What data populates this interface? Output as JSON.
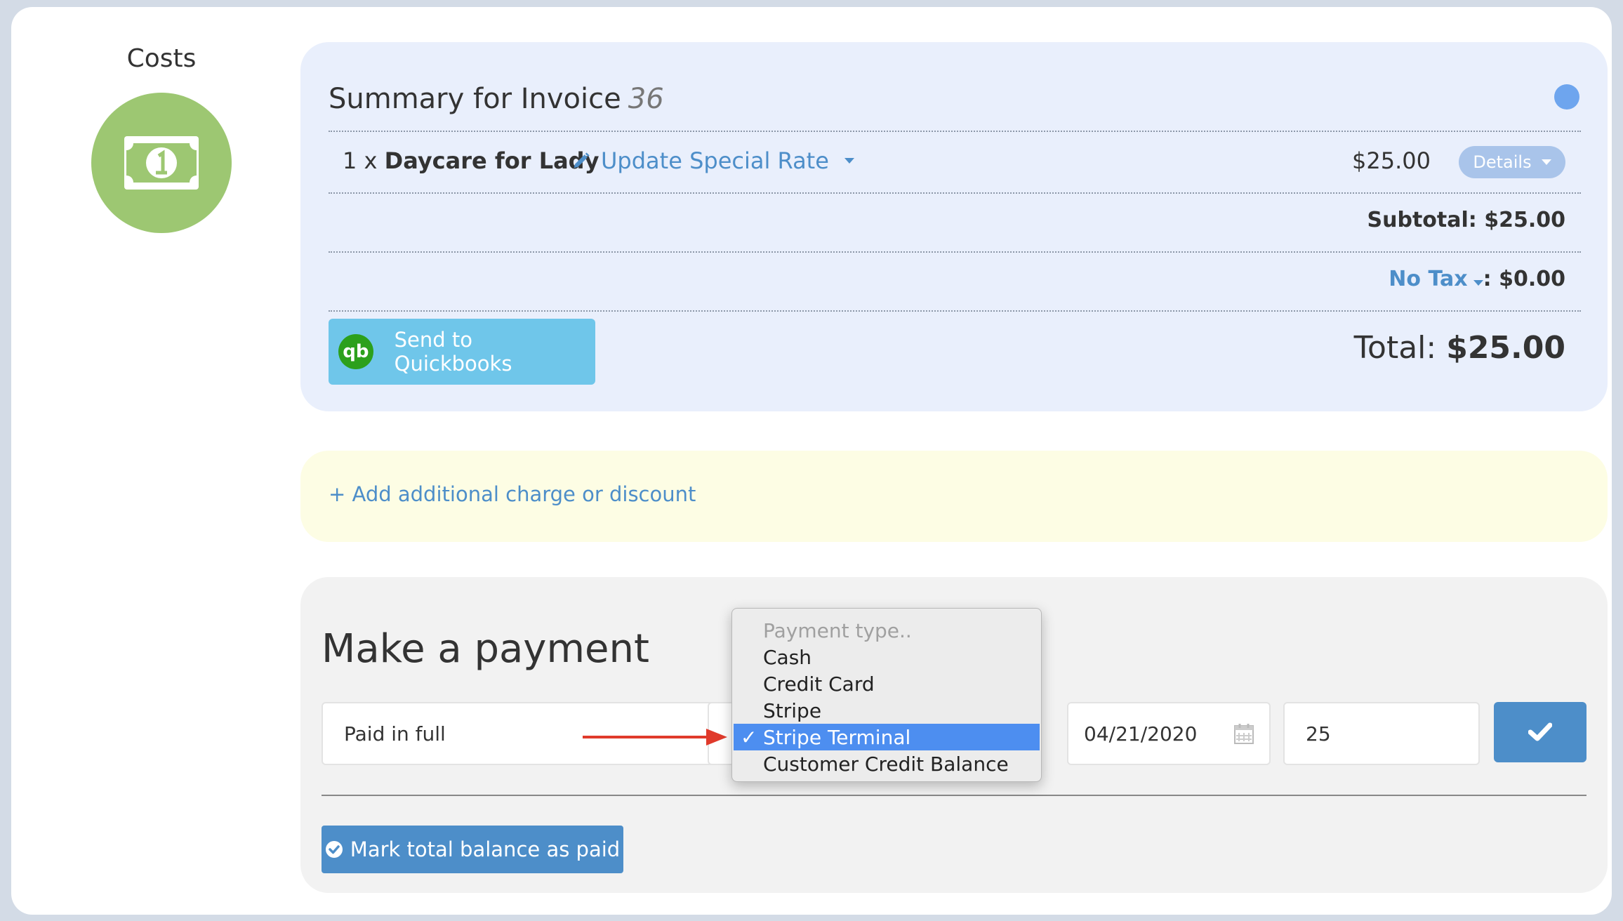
{
  "costs": {
    "label": "Costs",
    "icon": "money-icon",
    "accent": "#9dc772"
  },
  "summary": {
    "title": "Summary for Invoice",
    "invoice_number": "36",
    "status_color": "#6ea5ee",
    "line_item": {
      "qty_prefix": "1 x ",
      "name": "Daycare for Lady",
      "update_rate_label": "Update Special Rate",
      "price": "$25.00",
      "details_label": "Details"
    },
    "subtotal": "Subtotal: $25.00",
    "tax_label": "No Tax",
    "tax_amount": ": $0.00",
    "quickbooks_button": "Send to Quickbooks",
    "quickbooks_logo": "qb",
    "total_label": "Total: ",
    "total_value": "$25.00"
  },
  "additional": {
    "link": "+ Add additional charge or discount"
  },
  "payment": {
    "title": "Make a payment",
    "paid_value": "Paid in full",
    "date_value": "04/21/2020",
    "amount_value": "25",
    "mark_paid_label": "Mark total balance as paid",
    "accent": "#4d8ec9"
  },
  "payment_type_menu": {
    "placeholder": "Payment type..",
    "options": [
      "Cash",
      "Credit Card",
      "Stripe",
      "Stripe Terminal",
      "Customer Credit Balance"
    ],
    "selected": "Stripe Terminal",
    "selected_color": "#4d8ef0"
  }
}
